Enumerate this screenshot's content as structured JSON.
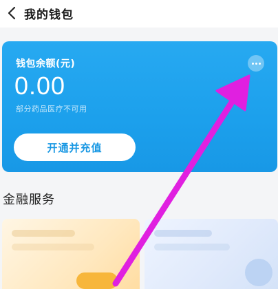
{
  "navbar": {
    "title": "我的钱包",
    "back_icon": "chevron-left-icon"
  },
  "wallet": {
    "balance_label": "钱包余额(元)",
    "balance_amount": "0.00",
    "note": "部分药品医疗不可用",
    "more_icon": "more-dots-icon",
    "open_button_label": "开通并充值",
    "card_color": "#1ca0ec",
    "button_text_color": "#1797e3"
  },
  "finance": {
    "section_title": "金融服务"
  },
  "annotation": {
    "arrow_color": "#e020e0",
    "arrow_icon": "pointer-arrow"
  }
}
